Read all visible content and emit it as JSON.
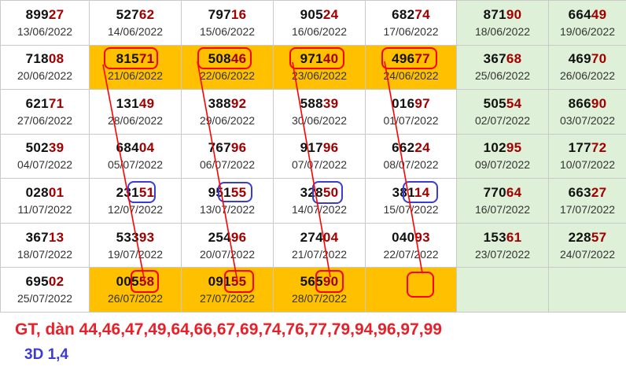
{
  "colors": {
    "highlight": "#ffc000",
    "weekend": "#dff0d8",
    "tail": "#a00000",
    "red_mark": "#ff0000",
    "blue_mark": "#3b3bd6"
  },
  "rows": [
    [
      {
        "head": "899",
        "tail": "27",
        "date": "13/06/2022"
      },
      {
        "head": "527",
        "tail": "62",
        "date": "14/06/2022"
      },
      {
        "head": "797",
        "tail": "16",
        "date": "15/06/2022"
      },
      {
        "head": "905",
        "tail": "24",
        "date": "16/06/2022"
      },
      {
        "head": "682",
        "tail": "74",
        "date": "17/06/2022"
      },
      {
        "head": "871",
        "tail": "90",
        "date": "18/06/2022"
      },
      {
        "head": "664",
        "tail": "49",
        "date": "19/06/2022"
      }
    ],
    [
      {
        "head": "718",
        "tail": "08",
        "date": "20/06/2022"
      },
      {
        "head": "815",
        "tail": "71",
        "date": "21/06/2022",
        "hl": true
      },
      {
        "head": "508",
        "tail": "46",
        "date": "22/06/2022",
        "hl": true
      },
      {
        "head": "971",
        "tail": "40",
        "date": "23/06/2022",
        "hl": true
      },
      {
        "head": "496",
        "tail": "77",
        "date": "24/06/2022",
        "hl": true
      },
      {
        "head": "367",
        "tail": "68",
        "date": "25/06/2022"
      },
      {
        "head": "469",
        "tail": "70",
        "date": "26/06/2022"
      }
    ],
    [
      {
        "head": "621",
        "tail": "71",
        "date": "27/06/2022"
      },
      {
        "head": "131",
        "tail": "49",
        "date": "28/06/2022"
      },
      {
        "head": "388",
        "tail": "92",
        "date": "29/06/2022"
      },
      {
        "head": "588",
        "tail": "39",
        "date": "30/06/2022"
      },
      {
        "head": "016",
        "tail": "97",
        "date": "01/07/2022"
      },
      {
        "head": "505",
        "tail": "54",
        "date": "02/07/2022"
      },
      {
        "head": "866",
        "tail": "90",
        "date": "03/07/2022"
      }
    ],
    [
      {
        "head": "502",
        "tail": "39",
        "date": "04/07/2022"
      },
      {
        "head": "684",
        "tail": "04",
        "date": "05/07/2022"
      },
      {
        "head": "767",
        "tail": "96",
        "date": "06/07/2022"
      },
      {
        "head": "917",
        "tail": "96",
        "date": "07/07/2022"
      },
      {
        "head": "662",
        "tail": "24",
        "date": "08/07/2022"
      },
      {
        "head": "102",
        "tail": "95",
        "date": "09/07/2022"
      },
      {
        "head": "177",
        "tail": "72",
        "date": "10/07/2022"
      }
    ],
    [
      {
        "head": "028",
        "tail": "01",
        "date": "11/07/2022"
      },
      {
        "head": "231",
        "tail": "51",
        "date": "12/07/2022"
      },
      {
        "head": "951",
        "tail": "55",
        "date": "13/07/2022"
      },
      {
        "head": "328",
        "tail": "50",
        "date": "14/07/2022"
      },
      {
        "head": "381",
        "tail": "14",
        "date": "15/07/2022"
      },
      {
        "head": "770",
        "tail": "64",
        "date": "16/07/2022"
      },
      {
        "head": "663",
        "tail": "27",
        "date": "17/07/2022"
      }
    ],
    [
      {
        "head": "367",
        "tail": "13",
        "date": "18/07/2022"
      },
      {
        "head": "533",
        "tail": "93",
        "date": "19/07/2022"
      },
      {
        "head": "254",
        "tail": "96",
        "date": "20/07/2022"
      },
      {
        "head": "274",
        "tail": "04",
        "date": "21/07/2022"
      },
      {
        "head": "040",
        "tail": "93",
        "date": "22/07/2022"
      },
      {
        "head": "153",
        "tail": "61",
        "date": "23/07/2022"
      },
      {
        "head": "228",
        "tail": "57",
        "date": "24/07/2022"
      }
    ],
    [
      {
        "head": "695",
        "tail": "02",
        "date": "25/07/2022"
      },
      {
        "head": "005",
        "tail": "58",
        "date": "26/07/2022",
        "hl": true
      },
      {
        "head": "091",
        "tail": "55",
        "date": "27/07/2022",
        "hl": true
      },
      {
        "head": "565",
        "tail": "90",
        "date": "28/07/2022",
        "hl": true
      },
      {
        "head": "",
        "tail": "",
        "date": "",
        "hl": true
      },
      {
        "head": "",
        "tail": "",
        "date": "",
        "weekend": true
      },
      {
        "head": "",
        "tail": "",
        "date": "",
        "weekend": true
      }
    ]
  ],
  "caption_gt": "GT, dàn 44,46,47,49,64,66,67,69,74,76,77,79,94,96,97,99",
  "caption_3d": "3D 1,4"
}
